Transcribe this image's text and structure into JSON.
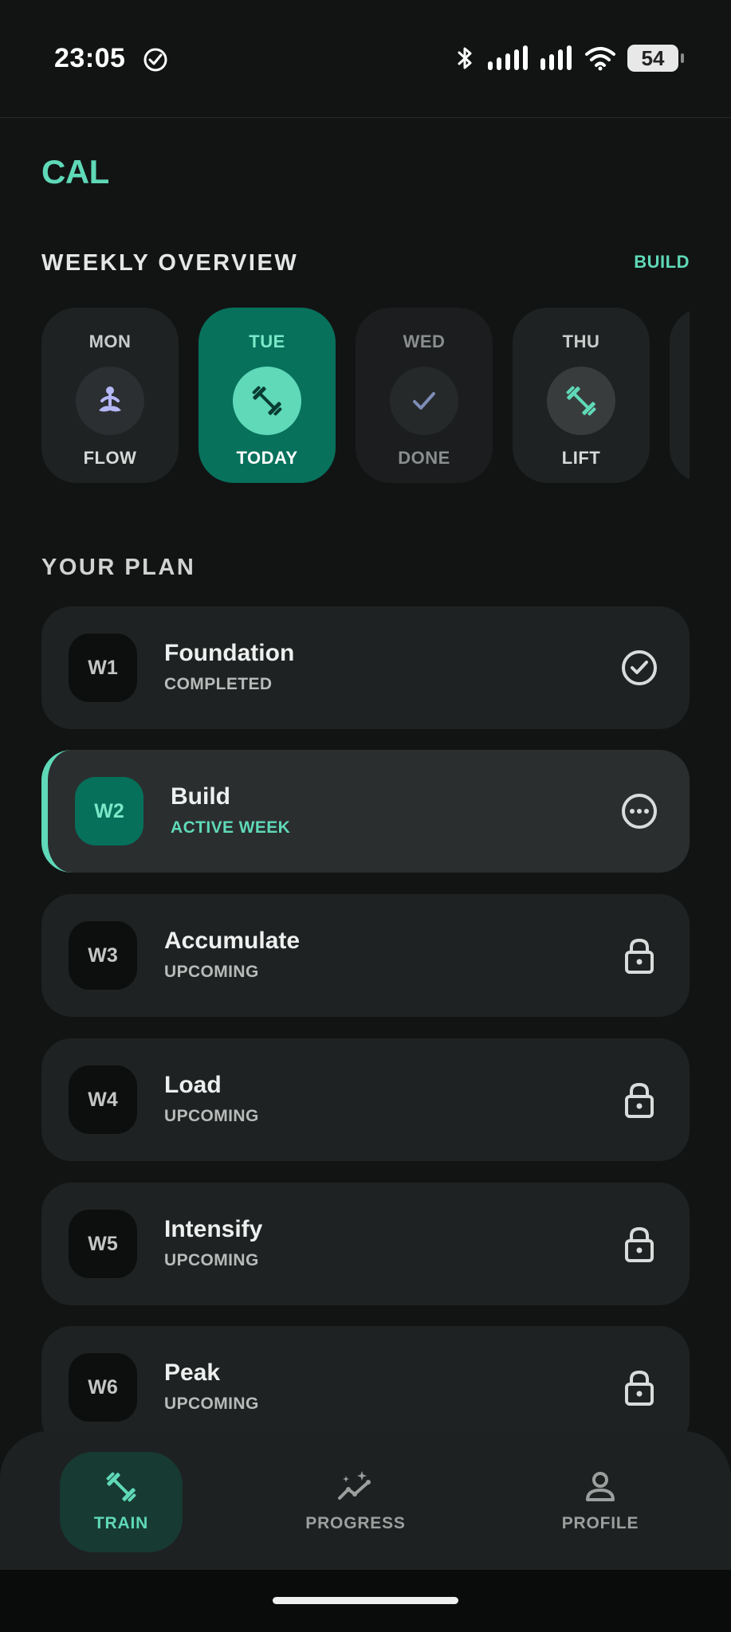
{
  "status_bar": {
    "time": "23:05",
    "battery": "54",
    "icons": [
      "check-circle-icon",
      "bluetooth-icon",
      "signal-icon",
      "signal-icon",
      "wifi-icon",
      "battery-icon"
    ]
  },
  "app": {
    "logo": "CAL"
  },
  "weekly_overview": {
    "title": "WEEKLY OVERVIEW",
    "link_label": "BUILD",
    "days": [
      {
        "day": "MON",
        "status": "FLOW",
        "icon": "meditation-icon"
      },
      {
        "day": "TUE",
        "status": "TODAY",
        "icon": "dumbbell-icon"
      },
      {
        "day": "WED",
        "status": "DONE",
        "icon": "check-icon"
      },
      {
        "day": "THU",
        "status": "LIFT",
        "icon": "dumbbell-icon"
      }
    ]
  },
  "plan": {
    "title": "YOUR PLAN",
    "weeks": [
      {
        "badge": "W1",
        "title": "Foundation",
        "status": "COMPLETED",
        "icon": "check-circle-icon"
      },
      {
        "badge": "W2",
        "title": "Build",
        "status": "ACTIVE WEEK",
        "icon": "more-circle-icon"
      },
      {
        "badge": "W3",
        "title": "Accumulate",
        "status": "UPCOMING",
        "icon": "lock-icon"
      },
      {
        "badge": "W4",
        "title": "Load",
        "status": "UPCOMING",
        "icon": "lock-icon"
      },
      {
        "badge": "W5",
        "title": "Intensify",
        "status": "UPCOMING",
        "icon": "lock-icon"
      },
      {
        "badge": "W6",
        "title": "Peak",
        "status": "UPCOMING",
        "icon": "lock-icon"
      }
    ]
  },
  "nav": {
    "items": [
      {
        "label": "TRAIN",
        "icon": "dumbbell-icon"
      },
      {
        "label": "PROGRESS",
        "icon": "progress-chart-icon"
      },
      {
        "label": "PROFILE",
        "icon": "person-icon"
      }
    ]
  },
  "colors": {
    "accent": "#5fd9b8",
    "accent_dark": "#07715c",
    "background": "#121414",
    "card": "#1f2222",
    "meditation": "#b4b7f5"
  }
}
